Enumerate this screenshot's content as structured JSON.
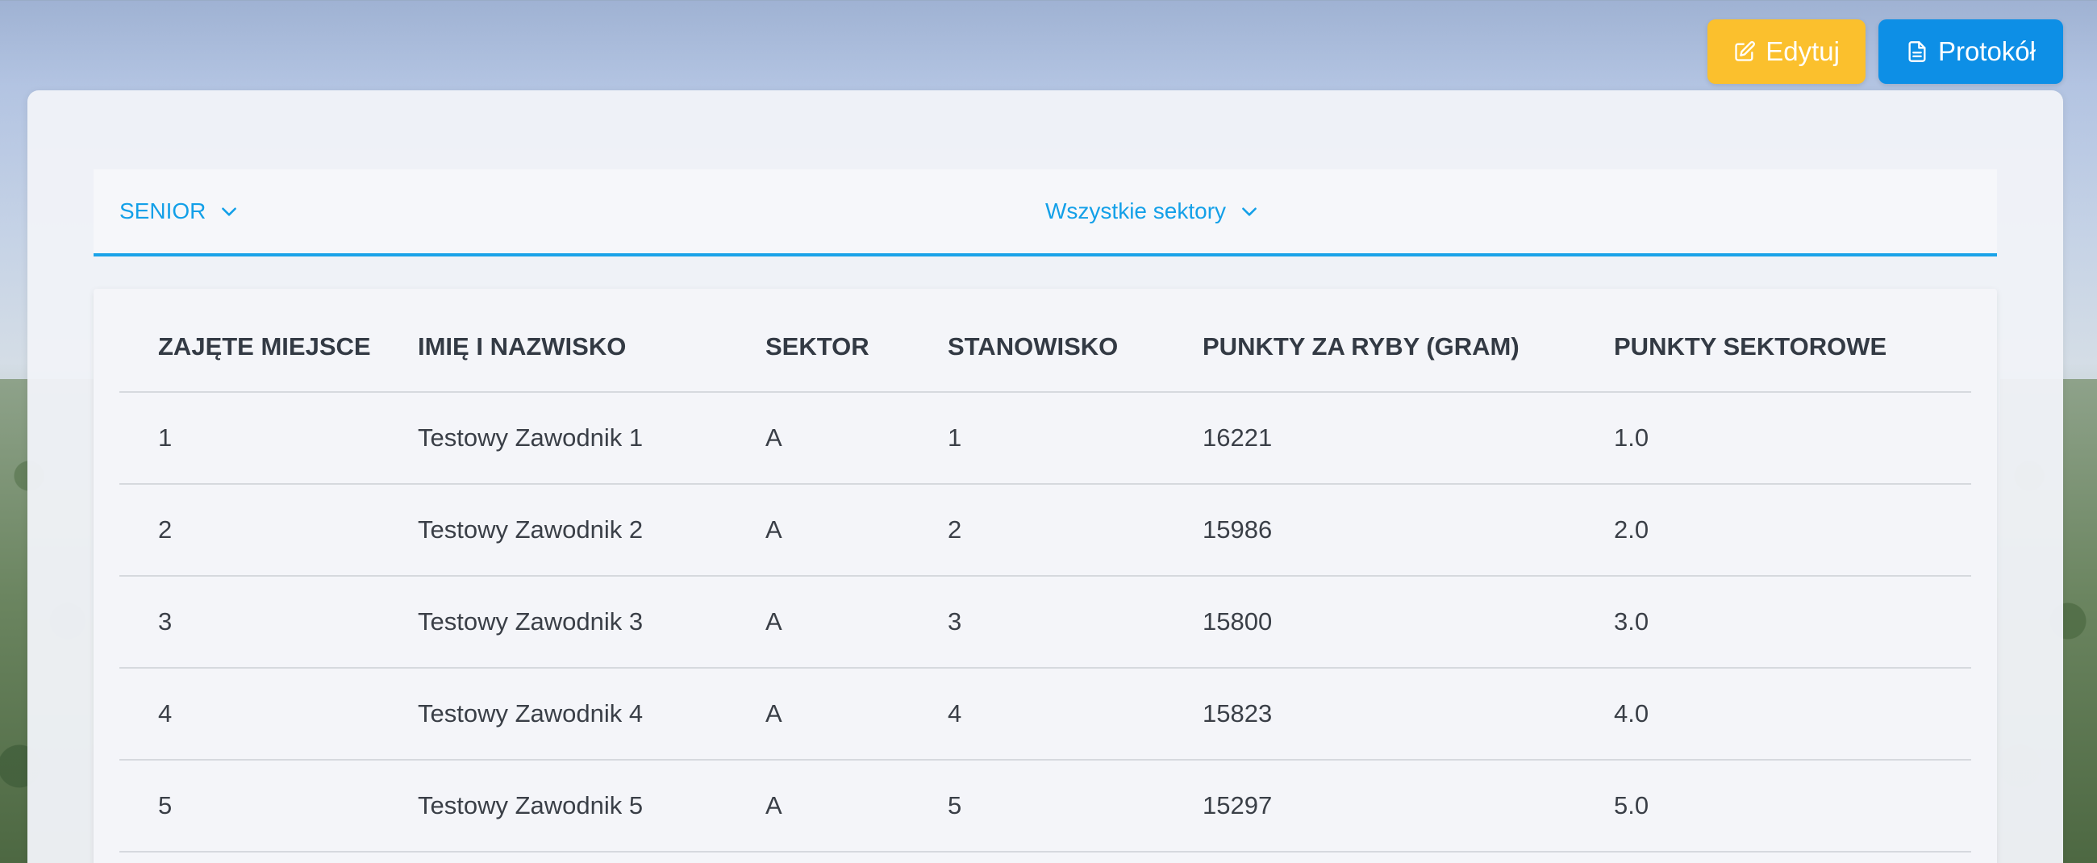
{
  "actions": {
    "edit_label": "Edytuj",
    "protocol_label": "Protokół"
  },
  "filters": {
    "category": "SENIOR",
    "sector": "Wszystkie sektory"
  },
  "table": {
    "headers": [
      "ZAJĘTE MIEJSCE",
      "IMIĘ I NAZWISKO",
      "SEKTOR",
      "STANOWISKO",
      "PUNKTY ZA RYBY (GRAM)",
      "PUNKTY SEKTOROWE"
    ],
    "rows": [
      [
        "1",
        "Testowy Zawodnik 1",
        "A",
        "1",
        "16221",
        "1.0"
      ],
      [
        "2",
        "Testowy Zawodnik 2",
        "A",
        "2",
        "15986",
        "2.0"
      ],
      [
        "3",
        "Testowy Zawodnik 3",
        "A",
        "3",
        "15800",
        "3.0"
      ],
      [
        "4",
        "Testowy Zawodnik 4",
        "A",
        "4",
        "15823",
        "4.0"
      ],
      [
        "5",
        "Testowy Zawodnik 5",
        "A",
        "5",
        "15297",
        "5.0"
      ]
    ]
  },
  "colors": {
    "edit_button": "#fbc02d",
    "protocol_button": "#0d8fe6",
    "accent": "#13a0e8"
  },
  "icons": {
    "edit": "edit-icon",
    "protocol": "document-icon",
    "dropdown": "chevron-down-icon"
  }
}
